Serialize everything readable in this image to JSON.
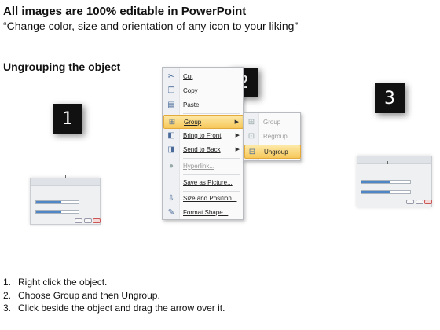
{
  "header": {
    "title": "All images are 100% editable in PowerPoint",
    "subtitle": "“Change color, size and orientation of any icon to your liking”"
  },
  "section_heading": "Ungrouping the object",
  "badges": [
    "1",
    "2",
    "3"
  ],
  "context_menu": {
    "items": [
      {
        "label": "Cut",
        "icon": "scissors-icon"
      },
      {
        "label": "Copy",
        "icon": "copy-icon"
      },
      {
        "label": "Paste",
        "icon": "paste-icon"
      },
      {
        "label": "Group",
        "icon": "group-icon",
        "submenu": true,
        "highlighted": true
      },
      {
        "label": "Bring to Front",
        "icon": "bring-front-icon",
        "submenu": true
      },
      {
        "label": "Send to Back",
        "icon": "send-back-icon",
        "submenu": true
      },
      {
        "label": "Hyperlink...",
        "icon": "hyperlink-icon",
        "disabled": true
      },
      {
        "label": "Save as Picture...",
        "icon": "save-picture-icon"
      },
      {
        "label": "Size and Position...",
        "icon": "size-position-icon"
      },
      {
        "label": "Format Shape...",
        "icon": "format-shape-icon"
      }
    ]
  },
  "submenu": {
    "items": [
      {
        "label": "Group",
        "icon": "group-icon",
        "disabled": true
      },
      {
        "label": "Regroup",
        "icon": "regroup-icon",
        "disabled": true
      },
      {
        "label": "Ungroup",
        "icon": "ungroup-icon",
        "highlighted": true
      }
    ]
  },
  "steps": [
    {
      "num": "1.",
      "text": "Right click the object."
    },
    {
      "num": "2.",
      "text": "Choose Group and then Ungroup."
    },
    {
      "num": "3.",
      "text": "Click beside the object and drag the arrow over it."
    }
  ],
  "colors": {
    "highlight": "#f7c85a",
    "badge": "#111111",
    "progress_fill": "#4f86c6"
  }
}
